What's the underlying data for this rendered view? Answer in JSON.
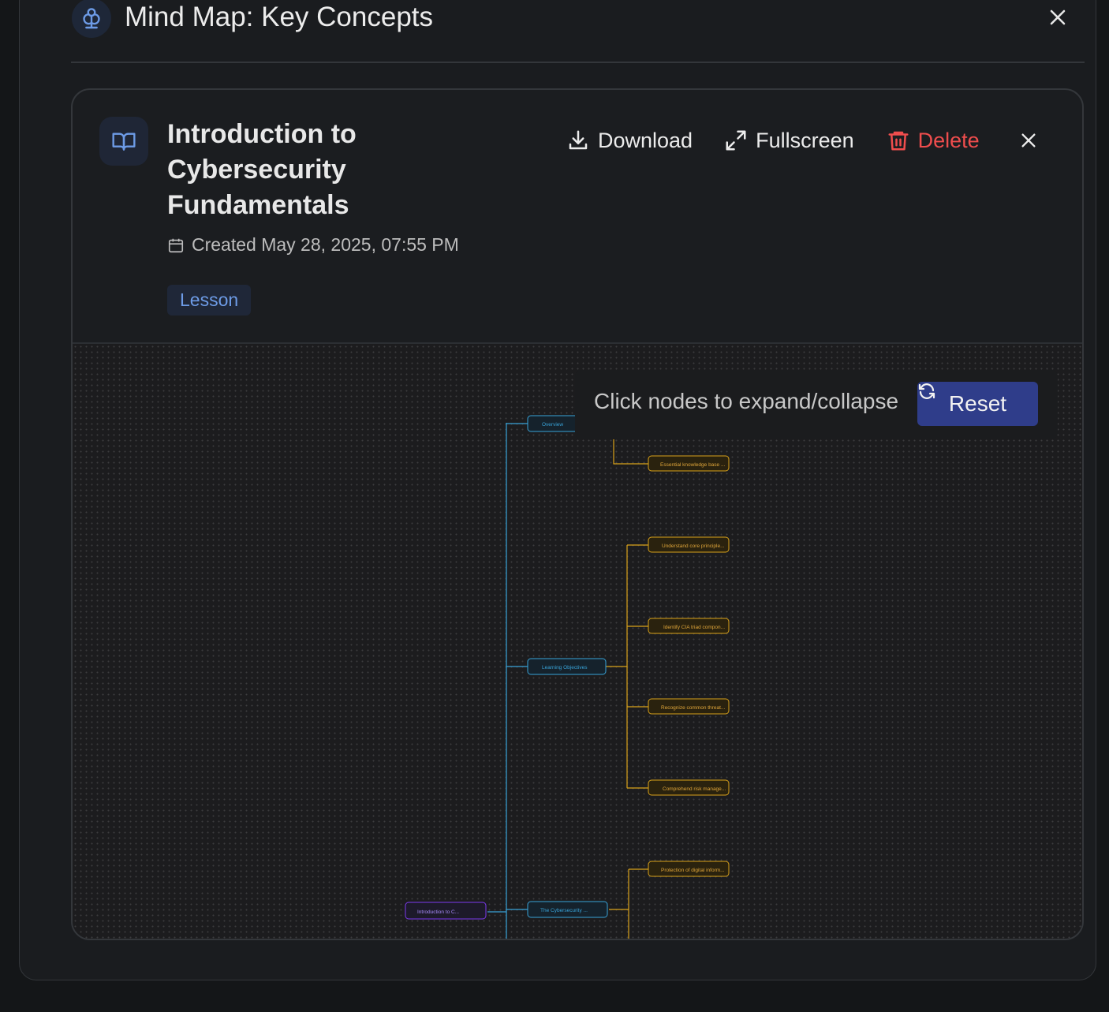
{
  "dialog": {
    "title": "Mind Map: Key Concepts",
    "icon": "mind-map-icon"
  },
  "card": {
    "title": "Introduction to Cybersecurity Fundamentals",
    "title_lines": [
      "Introduction to",
      "Cybersecurity",
      "Fundamentals"
    ],
    "created": "Created May 28, 2025, 07:55 PM",
    "tag": "Lesson",
    "actions": {
      "download": "Download",
      "fullscreen": "Fullscreen",
      "delete": "Delete"
    }
  },
  "canvas": {
    "hint": "Click nodes to expand/collapse",
    "reset_label": "Reset",
    "nodes": {
      "root": "Introduction to C...",
      "overview": "Overview",
      "objectives": "Learning Objectives",
      "landscape": "The Cybersecurity ...",
      "overview_child_1": "Essential knowledge base ...",
      "objective_1": "Understand core principle...",
      "objective_2": "Identify CIA triad compon...",
      "objective_3": "Recognize common threat...",
      "objective_4": "Comprehend risk manage...",
      "landscape_child_1": "Protection of digital inform..."
    }
  },
  "colors": {
    "accent": "#2f3d8a",
    "danger": "#ef4d4d",
    "tag": "#6d9be6",
    "level1": "#38a3d8",
    "level2": "#d9a21a",
    "root": "#7c3aed"
  }
}
